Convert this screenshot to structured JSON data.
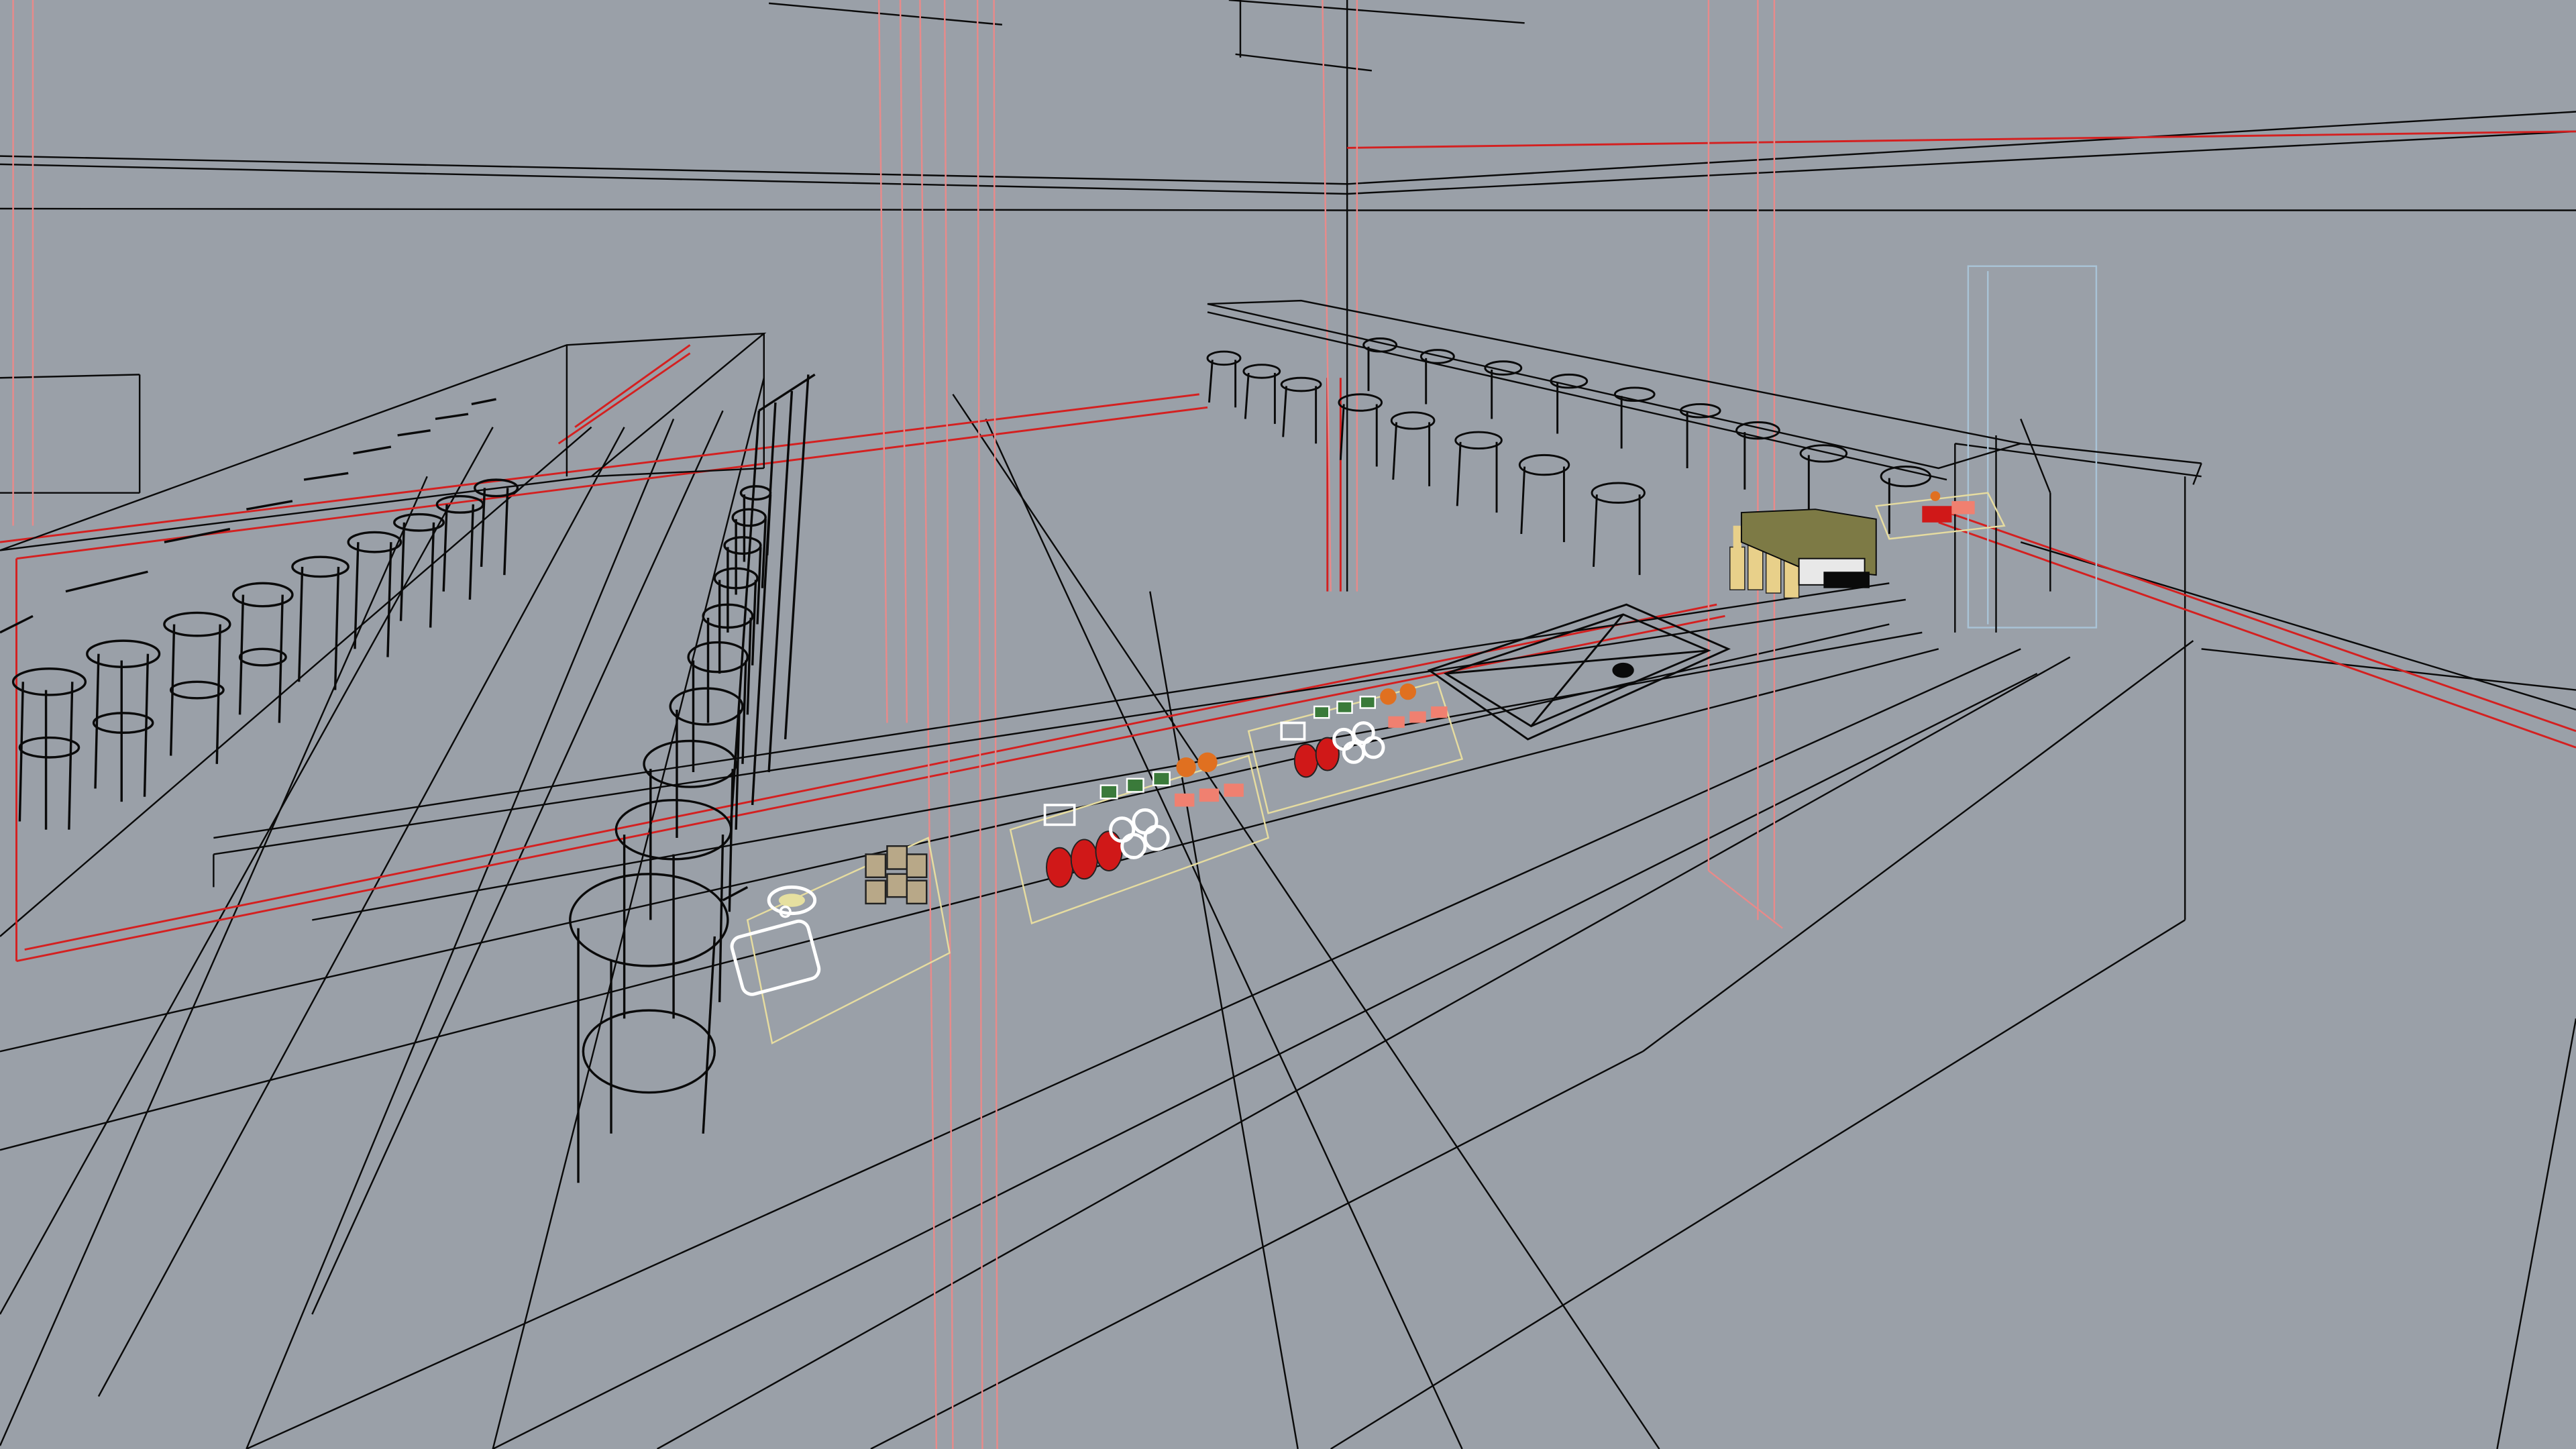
{
  "colors": {
    "viewport_background": "#9aa0a8",
    "wire_black": "#0a0a0a",
    "wire_red": "#d42020",
    "wire_pale_red": "#e88a8a",
    "wire_light_blue": "#a9c3d6",
    "food_red": "#d01818",
    "food_salmon": "#f08070",
    "bottle_yellow": "#e8d08a",
    "cabinet_olive": "#7d7a45",
    "tray_yellow_outline": "#e6dca0"
  },
  "scene": {
    "view_type": "3D perspective wireframe",
    "objects": [
      "bar-stools-left-row",
      "bar-stools-center-row",
      "bar-stools-back-row",
      "bar-counter",
      "food-display-trays",
      "bottles",
      "cabinet",
      "ceiling-beams",
      "columns"
    ]
  }
}
